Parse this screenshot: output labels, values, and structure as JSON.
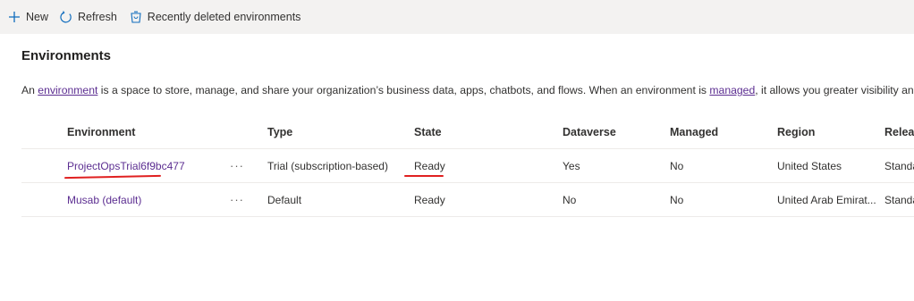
{
  "commandbar": {
    "new_label": "New",
    "refresh_label": "Refresh",
    "recently_deleted_label": "Recently deleted environments"
  },
  "page": {
    "title": "Environments",
    "desc_part1": "An ",
    "desc_link1": "environment",
    "desc_part2": " is a space to store, manage, and share your organization’s business data, apps, chatbots, and flows. When an environment is ",
    "desc_link2": "managed",
    "desc_part3": ", it allows you greater visibility and cont"
  },
  "table": {
    "columns": {
      "environment": "Environment",
      "type": "Type",
      "state": "State",
      "dataverse": "Dataverse",
      "managed": "Managed",
      "region": "Region",
      "release": "Release"
    },
    "rows": [
      {
        "environment": "ProjectOpsTrial6f9bc477",
        "more": "···",
        "type": "Trial (subscription-based)",
        "state": "Ready",
        "dataverse": "Yes",
        "managed": "No",
        "region": "United States",
        "release": "Standard"
      },
      {
        "environment": "Musab (default)",
        "more": "···",
        "type": "Default",
        "state": "Ready",
        "dataverse": "No",
        "managed": "No",
        "region": "United Arab Emirat...",
        "release": "Standard"
      }
    ]
  },
  "colors": {
    "accent_link": "#5c2e91",
    "annotation": "#e02020",
    "commandbar_bg": "#f3f2f1"
  },
  "icons": [
    "add-icon",
    "refresh-icon",
    "recycle-bin-icon",
    "more-options-icon"
  ]
}
